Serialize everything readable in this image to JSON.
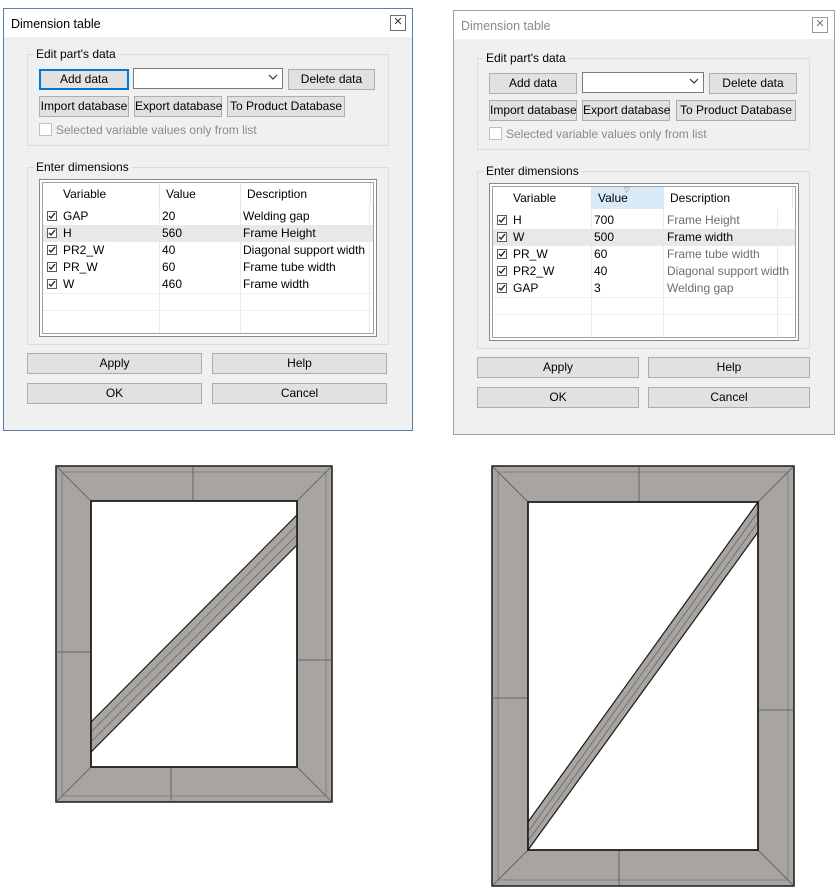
{
  "dialogs": [
    {
      "title": "Dimension table",
      "close_icon": "close-icon",
      "edit_group_label": "Edit part's data",
      "add_data": "Add data",
      "delete_data": "Delete data",
      "import_database": "Import database",
      "export_database": "Export database",
      "to_product_database": "To Product Database",
      "combo_value": "",
      "selected_only_label": "Selected variable values only from list",
      "dimensions_group_label": "Enter dimensions",
      "columns": [
        "Variable",
        "Value",
        "Description"
      ],
      "rows": [
        {
          "variable": "GAP",
          "value": "20",
          "description": "Welding gap",
          "checked": true
        },
        {
          "variable": "H",
          "value": "560",
          "description": "Frame Height",
          "checked": true
        },
        {
          "variable": "PR2_W",
          "value": "40",
          "description": "Diagonal support width",
          "checked": true
        },
        {
          "variable": "PR_W",
          "value": "60",
          "description": "Frame tube width",
          "checked": true
        },
        {
          "variable": "W",
          "value": "460",
          "description": "Frame width",
          "checked": true
        }
      ],
      "apply": "Apply",
      "help": "Help",
      "ok": "OK",
      "cancel": "Cancel"
    },
    {
      "title": "Dimension table",
      "close_icon": "close-icon",
      "edit_group_label": "Edit part's data",
      "add_data": "Add data",
      "delete_data": "Delete data",
      "import_database": "Import database",
      "export_database": "Export database",
      "to_product_database": "To Product Database",
      "combo_value": "",
      "selected_only_label": "Selected variable values only from list",
      "dimensions_group_label": "Enter dimensions",
      "columns": [
        "Variable",
        "Value",
        "Description"
      ],
      "rows": [
        {
          "variable": "H",
          "value": "700",
          "description": "Frame Height",
          "checked": true
        },
        {
          "variable": "W",
          "value": "500",
          "description": "Frame width",
          "checked": true
        },
        {
          "variable": "PR_W",
          "value": "60",
          "description": "Frame tube width",
          "checked": true
        },
        {
          "variable": "PR2_W",
          "value": "40",
          "description": "Diagonal support width",
          "checked": true
        },
        {
          "variable": "GAP",
          "value": "3",
          "description": "Welding gap",
          "checked": true
        }
      ],
      "apply": "Apply",
      "help": "Help",
      "ok": "OK",
      "cancel": "Cancel"
    }
  ],
  "colors": {
    "frame_fill": "#a8a5a0",
    "frame_line": "#1a1a1a",
    "accent": "#0078d7",
    "sorted_header": "#d9ebf9"
  }
}
